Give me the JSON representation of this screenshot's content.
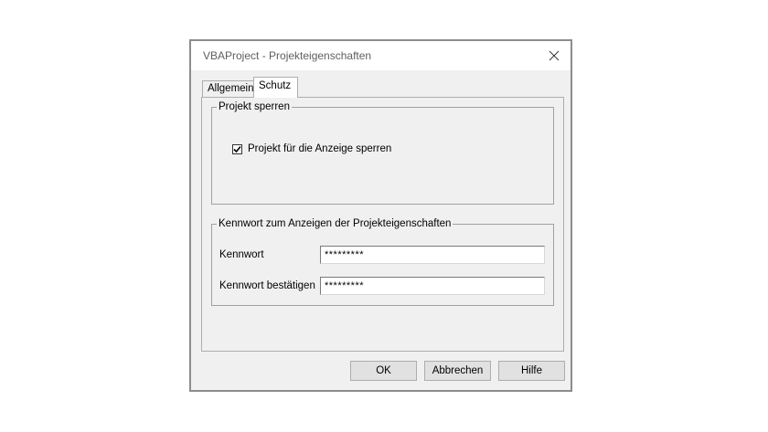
{
  "window": {
    "title": "VBAProject - Projekteigenschaften"
  },
  "tabs": [
    {
      "label": "Allgemein",
      "selected": false
    },
    {
      "label": "Schutz",
      "selected": true
    }
  ],
  "lock_group": {
    "legend": "Projekt sperren",
    "checkbox": {
      "label": "Projekt für die Anzeige sperren",
      "checked": true
    }
  },
  "password_group": {
    "legend": "Kennwort zum Anzeigen der Projekteigenschaften",
    "password": {
      "label": "Kennwort",
      "value": "*********"
    },
    "confirm": {
      "label": "Kennwort bestätigen",
      "value": "*********"
    }
  },
  "buttons": {
    "ok": "OK",
    "cancel": "Abbrechen",
    "help": "Hilfe"
  },
  "colors": {
    "dialog_background": "#f0f0f0",
    "title_bar": "#ffffff",
    "title_text": "#5f5f5f",
    "dialog_border": "#8c8c8c",
    "button_face": "#e1e1e1"
  },
  "icons": {
    "close": "close-icon",
    "checkmark": "checkmark-icon"
  }
}
